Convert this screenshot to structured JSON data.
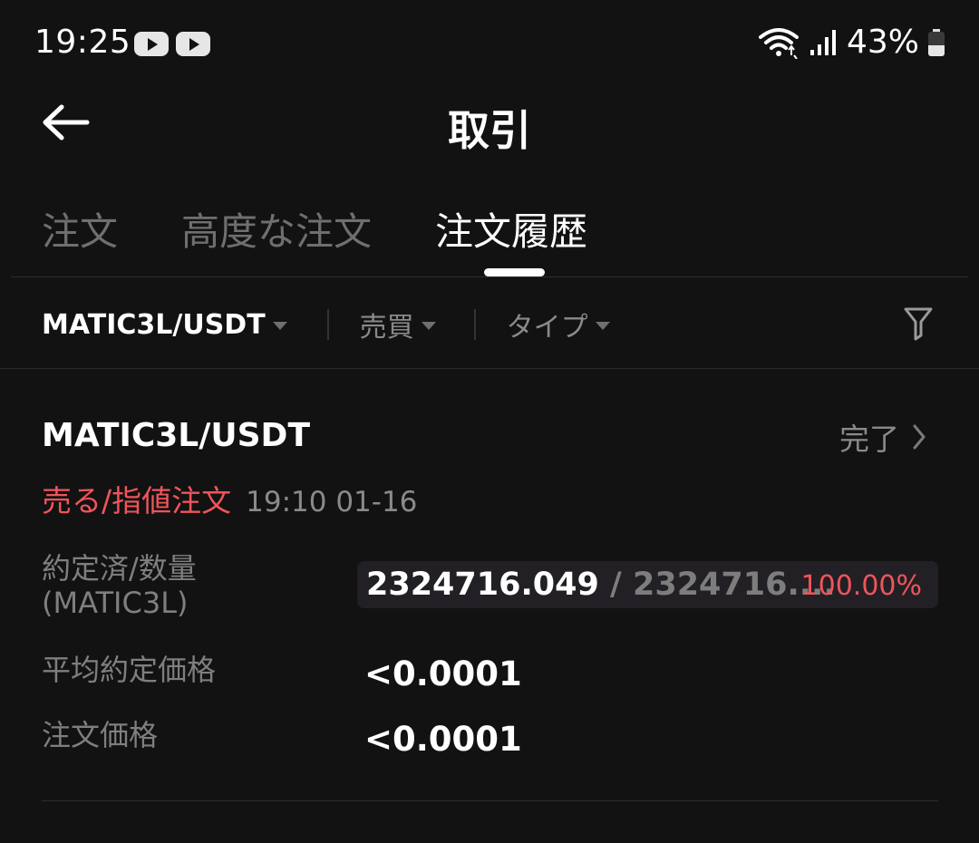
{
  "status_bar": {
    "time": "19:25",
    "notification_icons": [
      "youtube-icon",
      "youtube-icon"
    ],
    "battery_percent_label": "43%",
    "battery_level": 0.43,
    "icons": [
      "wifi-icon",
      "signal-icon",
      "battery-icon"
    ]
  },
  "header": {
    "title": "取引",
    "back_icon": "back-arrow-icon"
  },
  "tabs": [
    {
      "label": "注文",
      "active": false
    },
    {
      "label": "高度な注文",
      "active": false
    },
    {
      "label": "注文履歴",
      "active": true
    }
  ],
  "filters": {
    "symbol": "MATIC3L/USDT",
    "side": "売買",
    "type": "タイプ",
    "filter_icon": "funnel-icon"
  },
  "order": {
    "pair": "MATIC3L/USDT",
    "status": "完了",
    "side_type": "売る/指値注文",
    "datetime": "19:10 01-16",
    "filled_label": "約定済/数量",
    "filled_unit": "(MATIC3L)",
    "filled": "2324716.049",
    "separator": " / ",
    "total": "2324716....",
    "fill_percent": "100.00%",
    "avg_price_label": "平均約定価格",
    "avg_price": "<0.0001",
    "order_price_label": "注文価格",
    "order_price": "<0.0001"
  },
  "colors": {
    "background": "#121212",
    "sell_red": "#f0545b",
    "muted": "#7f7f7f"
  }
}
